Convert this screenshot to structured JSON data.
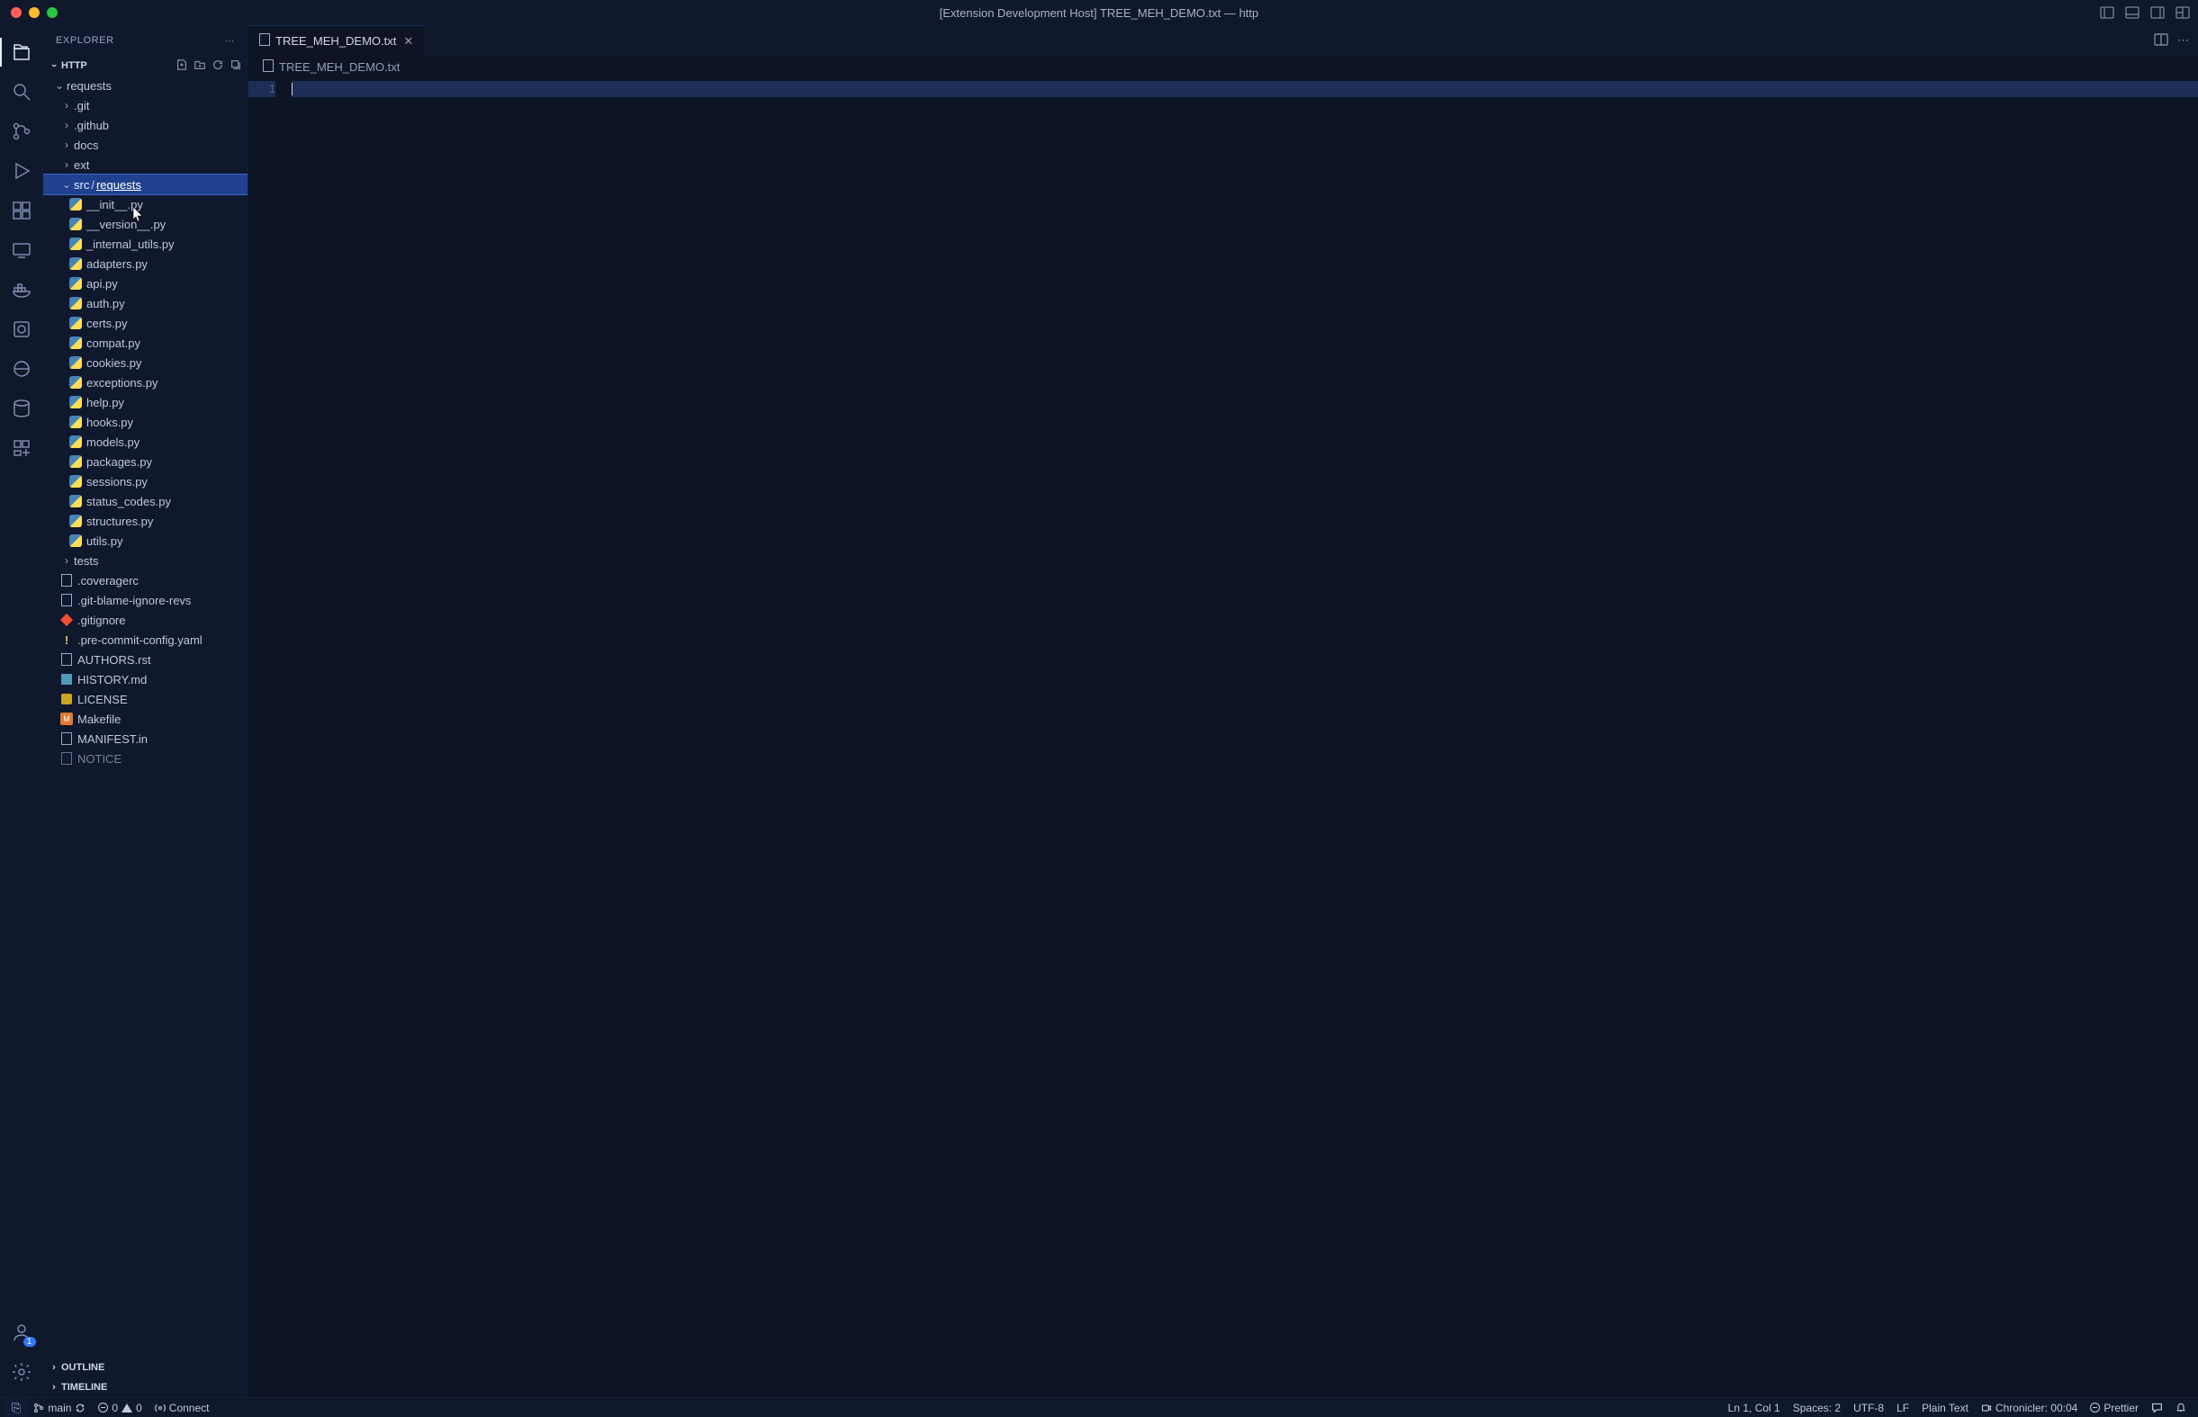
{
  "title": "[Extension Development Host] TREE_MEH_DEMO.txt — http",
  "sidebar": {
    "title": "EXPLORER",
    "section_name": "HTTP",
    "sections_collapsed": {
      "outline": "OUTLINE",
      "timeline": "TIMELINE"
    }
  },
  "file_tree": {
    "root": "requests",
    "folders_closed": [
      ".git",
      ".github",
      "docs",
      "ext"
    ],
    "selected_folder": {
      "parent": "src",
      "sep": "/ ",
      "name": "requests"
    },
    "src_files": [
      "__init__.py",
      "__version__.py",
      "_internal_utils.py",
      "adapters.py",
      "api.py",
      "auth.py",
      "certs.py",
      "compat.py",
      "cookies.py",
      "exceptions.py",
      "help.py",
      "hooks.py",
      "models.py",
      "packages.py",
      "sessions.py",
      "status_codes.py",
      "structures.py",
      "utils.py"
    ],
    "folder_tests": "tests",
    "root_files": [
      {
        "name": ".coveragerc",
        "icon": "text"
      },
      {
        "name": ".git-blame-ignore-revs",
        "icon": "text"
      },
      {
        "name": ".gitignore",
        "icon": "git"
      },
      {
        "name": ".pre-commit-config.yaml",
        "icon": "yaml"
      },
      {
        "name": "AUTHORS.rst",
        "icon": "text"
      },
      {
        "name": "HISTORY.md",
        "icon": "md"
      },
      {
        "name": "LICENSE",
        "icon": "lic"
      },
      {
        "name": "Makefile",
        "icon": "make"
      },
      {
        "name": "MANIFEST.in",
        "icon": "text"
      },
      {
        "name": "NOTICE",
        "icon": "text"
      }
    ]
  },
  "tab": {
    "name": "TREE_MEH_DEMO.txt",
    "breadcrumb": "TREE_MEH_DEMO.txt"
  },
  "editor": {
    "line_no": "1"
  },
  "status": {
    "branch": "main",
    "errors": "0",
    "warnings": "0",
    "connect": "Connect",
    "cursor": "Ln 1, Col 1",
    "spaces": "Spaces: 2",
    "encoding": "UTF-8",
    "eol": "LF",
    "lang": "Plain Text",
    "chronicler": "Chronicler: 00:04",
    "prettier": "Prettier"
  },
  "accounts_badge": "1"
}
